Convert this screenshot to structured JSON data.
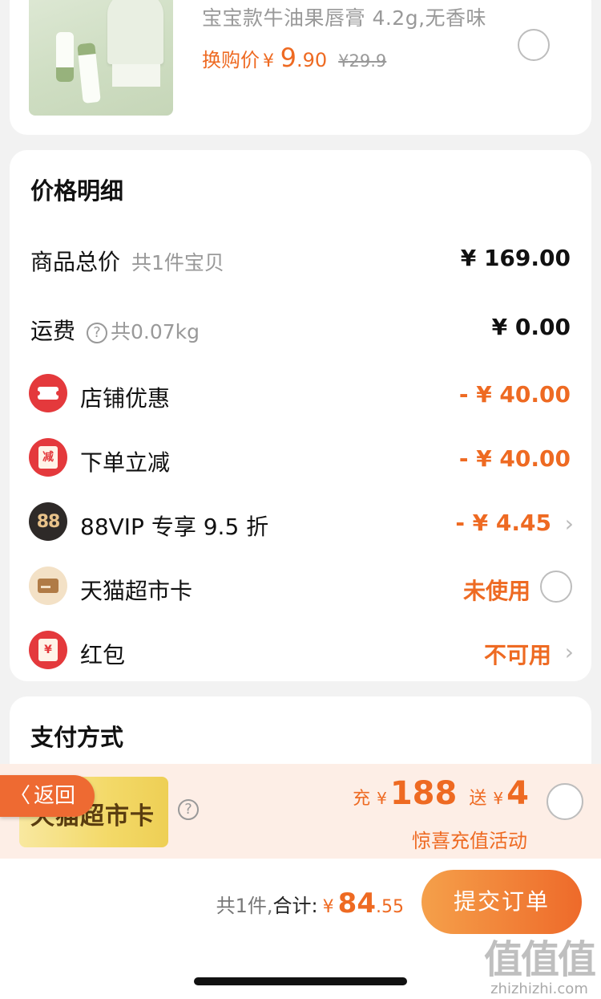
{
  "product": {
    "title": "宝宝款牛油果唇膏 4.2g,无香味",
    "price_label": "换购价",
    "yen": "¥",
    "price_int": "9",
    "price_dec": ".90",
    "original_price": "¥29.9"
  },
  "detail": {
    "heading": "价格明细",
    "rows": [
      {
        "label": "商品总价",
        "sub": "共1件宝贝",
        "value": "¥ 169.00"
      },
      {
        "label": "运费",
        "help": "?",
        "sub": "共0.07kg",
        "value": "¥ 0.00"
      },
      {
        "label": "店铺优惠",
        "value": "- ¥ 40.00"
      },
      {
        "label": "下单立减",
        "icon_text": "减",
        "value": "- ¥ 40.00"
      },
      {
        "label": "88VIP 专享 9.5 折",
        "icon_text": "88",
        "value": "- ¥ 4.45"
      },
      {
        "label": "天猫超市卡",
        "value": "未使用"
      },
      {
        "label": "红包",
        "icon_text": "¥",
        "value": "不可用"
      }
    ]
  },
  "payment": {
    "heading": "支付方式",
    "card_name": "天猫超市卡",
    "help": "?",
    "promo_charge_label": "充",
    "promo_charge_yen": "¥",
    "promo_charge_amount": "188",
    "promo_gift_label": "送",
    "promo_gift_yen": "¥",
    "promo_gift_amount": "4",
    "promo_subtitle": "惊喜充值活动"
  },
  "back": {
    "chevron": "〈",
    "label": "返回"
  },
  "footer": {
    "count_text": "共1件,",
    "sum_label": "合计:",
    "yen": "¥",
    "total_int": "84",
    "total_dec": ".55",
    "submit_label": "提交订单"
  },
  "watermark": {
    "main": "值值值",
    "url": "zhizhizhi.com"
  },
  "colors": {
    "accent": "#ee6a22",
    "danger": "#e4393c",
    "muted": "#999999"
  },
  "icons": {
    "shop_discount": "ticket-icon",
    "order_discount": "envelope-icon",
    "vip": "88vip-icon",
    "market_card": "card-icon",
    "red_packet": "red-packet-icon"
  }
}
